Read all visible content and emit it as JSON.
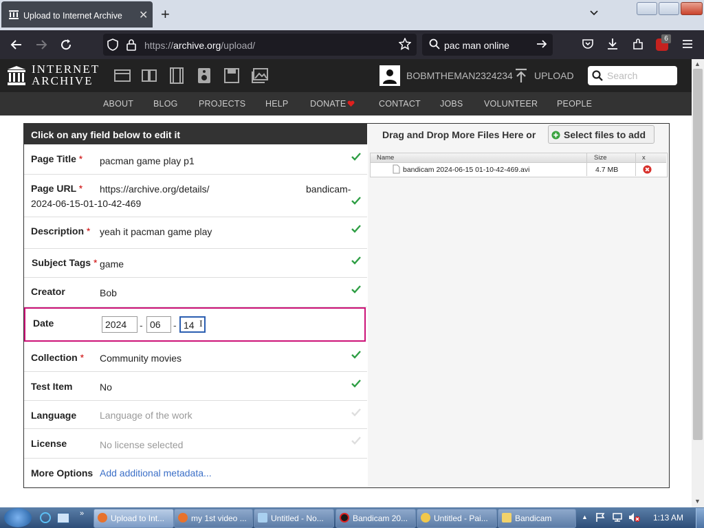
{
  "browser": {
    "tab_title": "Upload to Internet Archive",
    "url_prefix": "https://",
    "url_domain": "archive.org",
    "url_path": "/upload/",
    "search_text": "pac man online",
    "extension_badge": "6"
  },
  "ia": {
    "logo_line1": "INTERNET",
    "logo_line2": "ARCHIVE",
    "username": "BOBMTHEMAN2324234",
    "upload_label": "UPLOAD",
    "search_placeholder": "Search",
    "nav": [
      "ABOUT",
      "BLOG",
      "PROJECTS",
      "HELP",
      "DONATE",
      "CONTACT",
      "JOBS",
      "VOLUNTEER",
      "PEOPLE"
    ]
  },
  "form": {
    "header": "Click on any field below to edit it",
    "fields": {
      "page_title": {
        "label": "Page Title",
        "value": "pacman game play p1"
      },
      "page_url": {
        "label": "Page URL",
        "value_base": "https://archive.org/details/",
        "value_id_a": "bandicam-",
        "value_id_b": "2024-06-15-01-10-42-469"
      },
      "description": {
        "label": "Description",
        "value": "yeah it pacman game play"
      },
      "subject_tags": {
        "label": "Subject Tags",
        "value": "game"
      },
      "creator": {
        "label": "Creator",
        "value": "Bob"
      },
      "date": {
        "label": "Date",
        "year": "2024",
        "month": "06",
        "day": "14"
      },
      "collection": {
        "label": "Collection",
        "value": "Community movies"
      },
      "test_item": {
        "label": "Test Item",
        "value": "No"
      },
      "language": {
        "label": "Language",
        "placeholder": "Language of the work"
      },
      "license": {
        "label": "License",
        "placeholder": "No license selected"
      },
      "more_options": {
        "label": "More Options",
        "link": "Add additional metadata..."
      }
    },
    "required_mark": "*",
    "date_sep": "-"
  },
  "files": {
    "drag_text": "Drag and Drop More Files Here or",
    "select_button": "Select files to add",
    "columns": [
      "Name",
      "Size",
      "x"
    ],
    "rows": [
      {
        "name": "bandicam 2024-06-15 01-10-42-469.avi",
        "size": "4.7 MB"
      }
    ]
  },
  "taskbar": {
    "items": [
      "Upload to Int...",
      "my 1st video ...",
      "Untitled - No...",
      "Bandicam 20...",
      "Untitled - Pai...",
      "Bandicam"
    ],
    "clock": "1:13 AM"
  },
  "colors": {
    "date_highlight": "#cc1177",
    "check": "#2e9e44",
    "required": "#cc0000"
  }
}
